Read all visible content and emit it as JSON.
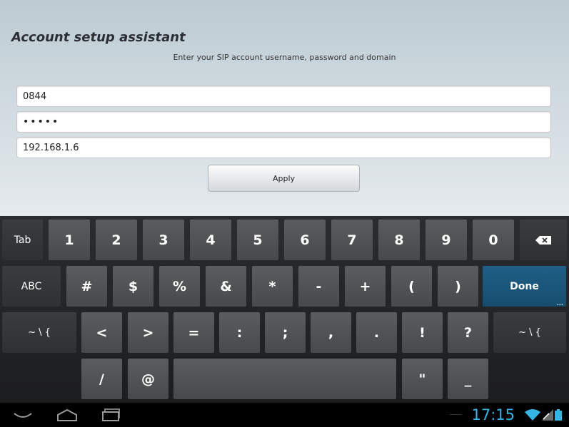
{
  "app": {
    "title": "Account setup assistant",
    "subtitle": "Enter your SIP account username, password and domain",
    "fields": {
      "username": "0844",
      "password": "•••••",
      "domain": "192.168.1.6"
    },
    "apply_label": "Apply"
  },
  "keyboard": {
    "row1": [
      "Tab",
      "1",
      "2",
      "3",
      "4",
      "5",
      "6",
      "7",
      "8",
      "9",
      "0"
    ],
    "backspace_icon": "backspace-icon",
    "row2": [
      "ABC",
      "#",
      "$",
      "%",
      "&",
      "*",
      "-",
      "+",
      "(",
      ")",
      "Done"
    ],
    "row3": [
      "~ \\ {",
      "<",
      ">",
      "=",
      ":",
      ";",
      ",",
      ".",
      "!",
      "?",
      "~ \\ {"
    ],
    "row4": [
      "/",
      "@",
      "",
      "\"",
      "_"
    ]
  },
  "navbar": {
    "icons": [
      "back-icon",
      "home-icon",
      "recent-apps-icon"
    ]
  },
  "status": {
    "time": "17:15",
    "icons": [
      "wifi-icon",
      "signal-icon",
      "battery-icon"
    ],
    "accent_color": "#33b5e5"
  }
}
